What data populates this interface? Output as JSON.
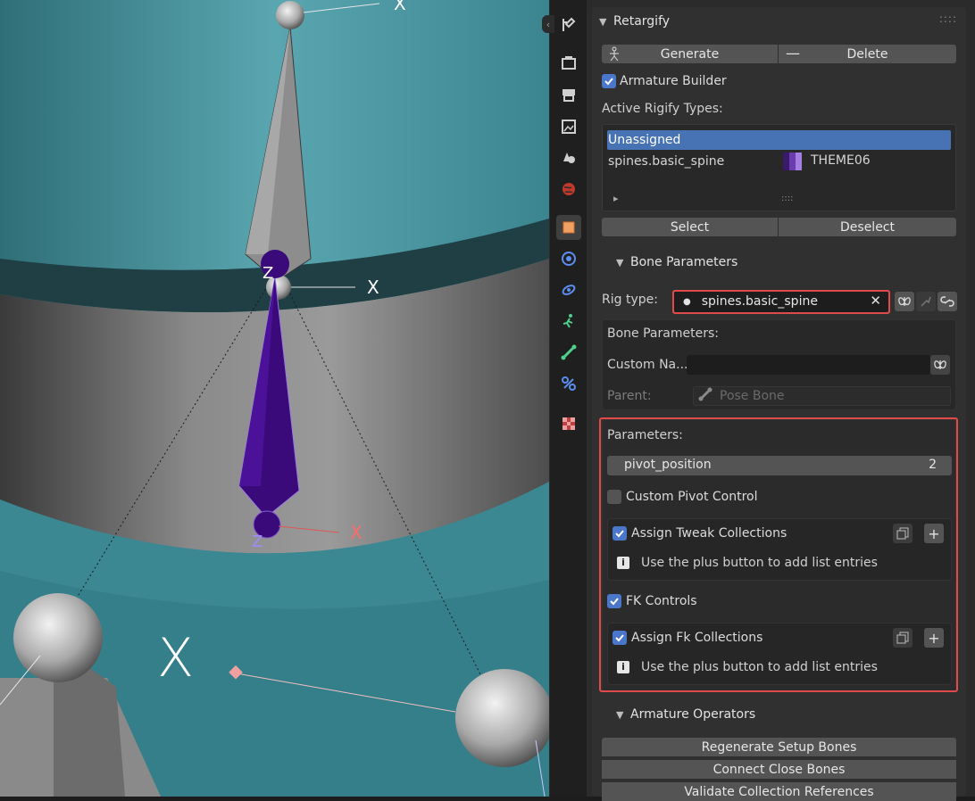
{
  "retargify": {
    "title": "Retargify",
    "generate_label": "Generate",
    "delete_label": "Delete",
    "armature_builder_label": "Armature Builder",
    "active_types_label": "Active Rigify Types:",
    "list_items": [
      {
        "label": "Unassigned",
        "theme": ""
      },
      {
        "label": "spines.basic_spine",
        "theme": "THEME06"
      }
    ],
    "list_grip": "::::",
    "list_expand": "▸",
    "select_label": "Select",
    "deselect_label": "Deselect"
  },
  "bone_params": {
    "section_title": "Bone Parameters",
    "rig_type_label": "Rig type:",
    "rig_type_value": "spines.basic_spine",
    "sub_title": "Bone Parameters:",
    "custom_name_label": "Custom Na...",
    "parent_label": "Parent:",
    "parent_placeholder": "Pose Bone"
  },
  "parameters": {
    "title": "Parameters:",
    "pivot_label": "pivot_position",
    "pivot_value": "2",
    "custom_pivot_label": "Custom Pivot Control",
    "assign_tweak_label": "Assign Tweak Collections",
    "tweak_info": "Use the plus button to add list entries",
    "fk_controls_label": "FK Controls",
    "assign_fk_label": "Assign Fk Collections",
    "fk_info": "Use the plus button to add list entries",
    "plus": "+"
  },
  "armature_ops": {
    "title": "Armature Operators",
    "buttons": [
      "Regenerate Setup Bones",
      "Connect Close Bones",
      "Validate Collection References"
    ]
  },
  "viewport": {
    "axis_x": "X",
    "axis_z": "Z"
  },
  "colors": {
    "accent_blue": "#4772b3",
    "highlight_red": "#e04a4a",
    "bone_purple": "#3a0a7a",
    "viewport_teal": "#3e8a95"
  }
}
